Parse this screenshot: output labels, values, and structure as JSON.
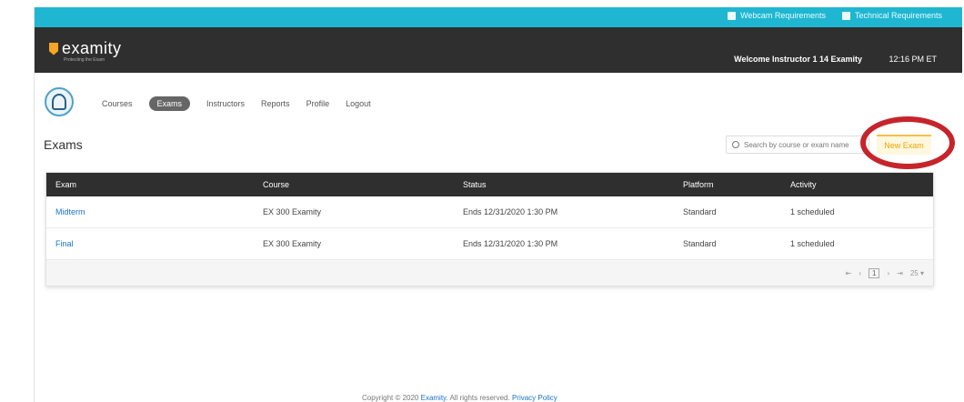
{
  "topbar": {
    "link1": "Webcam Requirements",
    "link2": "Technical Requirements",
    "accent": "#1fb6d1"
  },
  "header": {
    "logo": "examity",
    "tagline": "Protecting the Exam",
    "welcome": "Welcome Instructor 1 14 Examity",
    "time": "12:16 PM ET"
  },
  "nav": [
    "Courses",
    "Exams",
    "Instructors",
    "Reports",
    "Profile",
    "Logout"
  ],
  "page": {
    "title": "Exams",
    "search_placeholder": "Search by course or exam name",
    "new_button": "New Exam"
  },
  "table": {
    "headers": [
      "Exam",
      "Course",
      "Status",
      "Platform",
      "Activity"
    ],
    "rows": [
      [
        "Midterm",
        "EX 300 Examity",
        "Ends 12/31/2020 1:30 PM",
        "Standard",
        "1 scheduled"
      ],
      [
        "Final",
        "EX 300 Examity",
        "Ends 12/31/2020 1:30 PM",
        "Standard",
        "1 scheduled"
      ]
    ],
    "pager": {
      "page": "1",
      "per_page": "25"
    }
  },
  "footer": {
    "prefix": "Copyright © 2020",
    "brand": "Examity",
    "rights": ". All rights reserved.",
    "privacy": "Privacy Policy"
  },
  "colors": {
    "highlight_ring": "#c6242b",
    "new_button": "#f0a200"
  }
}
